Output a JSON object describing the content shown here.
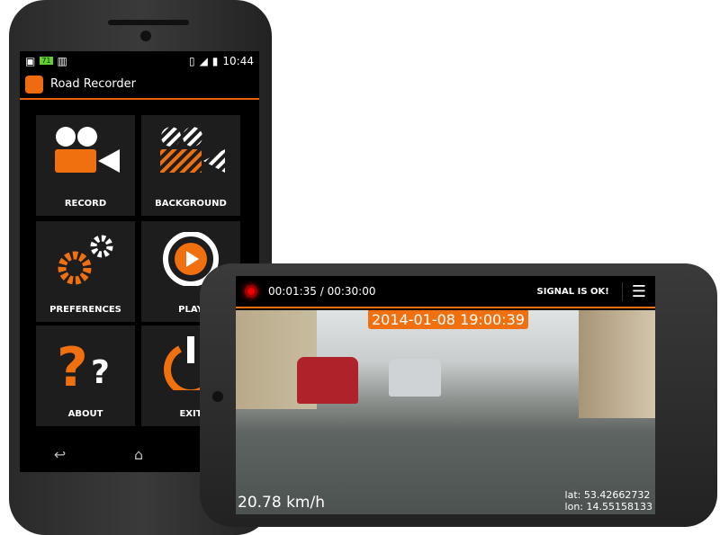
{
  "portrait": {
    "status": {
      "time": "10:44",
      "notif_badge": "71"
    },
    "app_title": "Road Recorder",
    "tiles": [
      {
        "label": "RECORD",
        "icon": "video-camera-icon"
      },
      {
        "label": "BACKGROUND",
        "icon": "striped-camera-icon"
      },
      {
        "label": "PREFERENCES",
        "icon": "gears-icon"
      },
      {
        "label": "PLAY",
        "icon": "play-circle-icon"
      },
      {
        "label": "ABOUT",
        "icon": "question-marks-icon"
      },
      {
        "label": "EXIT",
        "icon": "power-icon"
      }
    ],
    "nav": {
      "back": "↩",
      "home": "⌂",
      "recents": "▭"
    }
  },
  "landscape": {
    "elapsed": "00:01:35 / 00:30:00",
    "signal": "SIGNAL IS OK!",
    "timestamp": "2014-01-08 19:00:39",
    "speed": "20.78 km/h",
    "lat": "lat: 53.42662732",
    "lon": "lon: 14.55158133"
  },
  "colors": {
    "accent": "#f07010",
    "record": "#e00000"
  }
}
